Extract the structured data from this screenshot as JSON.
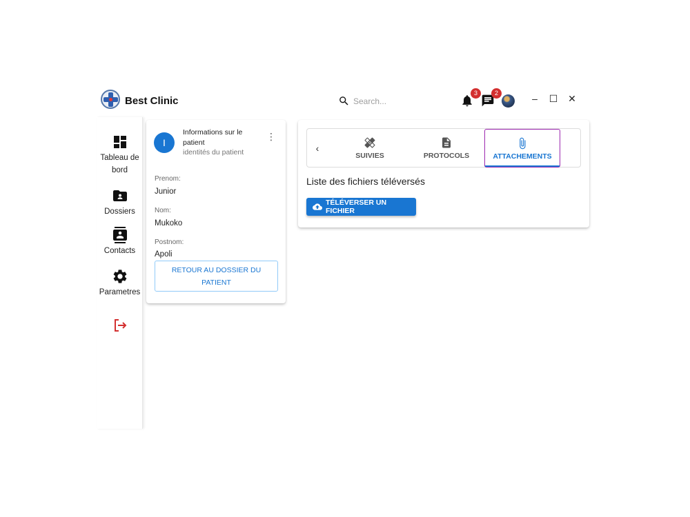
{
  "app": {
    "brand": "Best Clinic",
    "search_placeholder": "Search...",
    "notifications_count": "3",
    "messages_count": "2"
  },
  "window_controls": {
    "minimize": "–",
    "maximize": "☐",
    "close": "✕"
  },
  "sidebar": {
    "items": [
      {
        "label": "Tableau de bord",
        "icon": "dashboard-icon"
      },
      {
        "label": "Dossiers",
        "icon": "folder-person-icon"
      },
      {
        "label": "Contacts",
        "icon": "contacts-icon"
      },
      {
        "label": "Parametres",
        "icon": "gear-icon"
      }
    ],
    "logout_icon": "logout-icon",
    "logout_color": "#d32f2f"
  },
  "patient_card": {
    "avatar_letter": "I",
    "title": "Informations sur le patient",
    "subtitle": "identités du patient",
    "fields": [
      {
        "label": "Prenom:",
        "value": "Junior"
      },
      {
        "label": "Nom:",
        "value": "Mukoko"
      },
      {
        "label": "Postnom:",
        "value": "Apoli"
      }
    ],
    "back_button": "RETOUR AU DOSSIER DU PATIENT"
  },
  "attachments_card": {
    "tabs": [
      {
        "label": "SUIVIES",
        "icon": "bandage-icon",
        "active": false
      },
      {
        "label": "PROTOCOLS",
        "icon": "document-icon",
        "active": false
      },
      {
        "label": "ATTACHEMENTS",
        "icon": "paperclip-icon",
        "active": true
      }
    ],
    "list_title": "Liste des fichiers téléversés",
    "upload_button": "TÉLÉVERSER UN FICHIER"
  },
  "colors": {
    "primary": "#1976d2",
    "badge": "#d32f2f",
    "active_tab_outline": "#9c27b0"
  }
}
